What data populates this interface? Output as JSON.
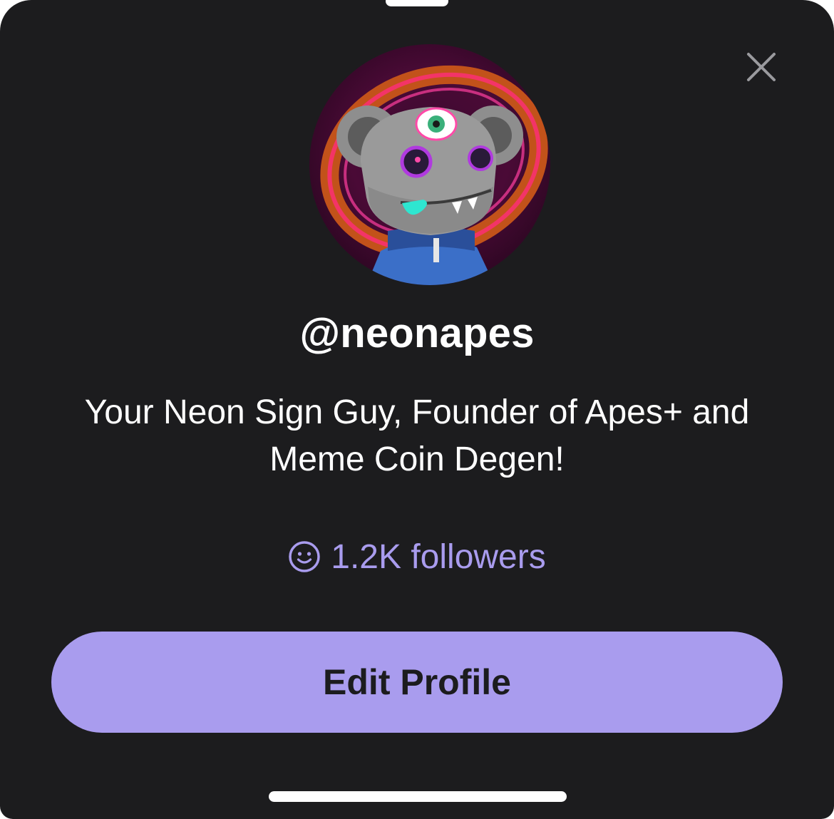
{
  "profile": {
    "username": "@neonapes",
    "bio": "Your Neon Sign Guy, Founder of Apes+ and Meme Coin Degen!",
    "followers_label": "1.2K followers"
  },
  "actions": {
    "edit_profile_label": "Edit Profile"
  },
  "icons": {
    "close": "close-icon",
    "followers": "smiley-face-icon",
    "avatar": "nft-ape-avatar"
  },
  "colors": {
    "sheet_background": "#1c1c1e",
    "accent": "#a99cee",
    "text_primary": "#ffffff"
  }
}
